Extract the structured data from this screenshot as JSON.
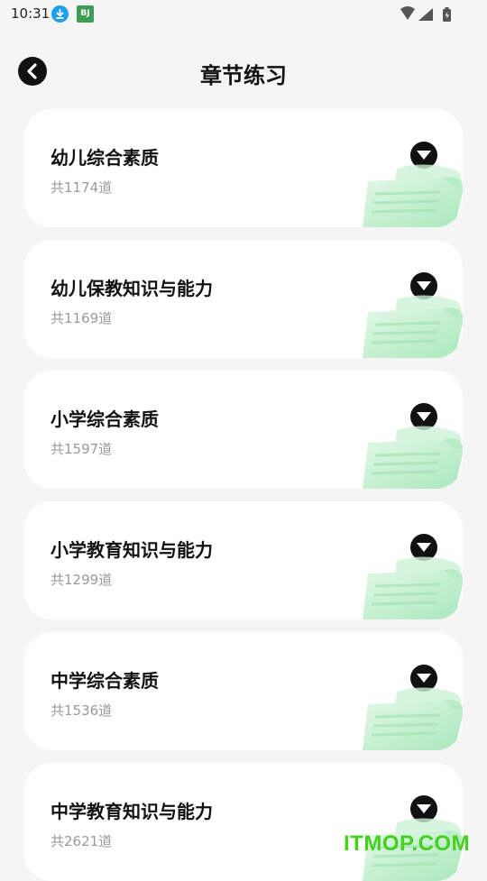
{
  "status_bar": {
    "time": "10:31",
    "app_badge": "BJ"
  },
  "header": {
    "title": "章节练习"
  },
  "chapters": [
    {
      "title": "幼儿综合素质",
      "count": "共1174道"
    },
    {
      "title": "幼儿保教知识与能力",
      "count": "共1169道"
    },
    {
      "title": "小学综合素质",
      "count": "共1597道"
    },
    {
      "title": "小学教育知识与能力",
      "count": "共1299道"
    },
    {
      "title": "中学综合素质",
      "count": "共1536道"
    },
    {
      "title": "中学教育知识与能力",
      "count": "共2621道"
    }
  ],
  "watermark": "ITMOP.COM",
  "colors": {
    "background": "#f5f5f5",
    "card": "#ffffff",
    "accent_green": "#43d11e",
    "scroll_green": "#bfeecb"
  }
}
